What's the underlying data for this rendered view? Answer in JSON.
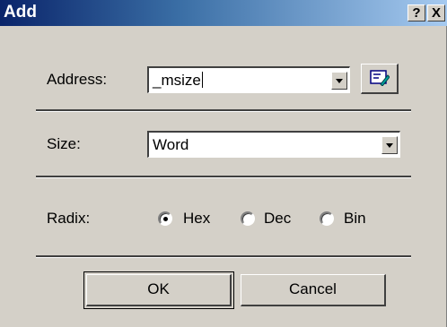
{
  "window": {
    "title": "Add",
    "help_glyph": "?",
    "close_glyph": "X"
  },
  "address": {
    "label": "Address:",
    "value": "_msize",
    "browse_icon": "symbol-browse-icon"
  },
  "size": {
    "label": "Size:",
    "value": "Word"
  },
  "radix": {
    "label": "Radix:",
    "options": [
      {
        "label": "Hex",
        "selected": true
      },
      {
        "label": "Dec",
        "selected": false
      },
      {
        "label": "Bin",
        "selected": false
      }
    ]
  },
  "buttons": {
    "ok_label": "OK",
    "cancel_label": "Cancel"
  }
}
